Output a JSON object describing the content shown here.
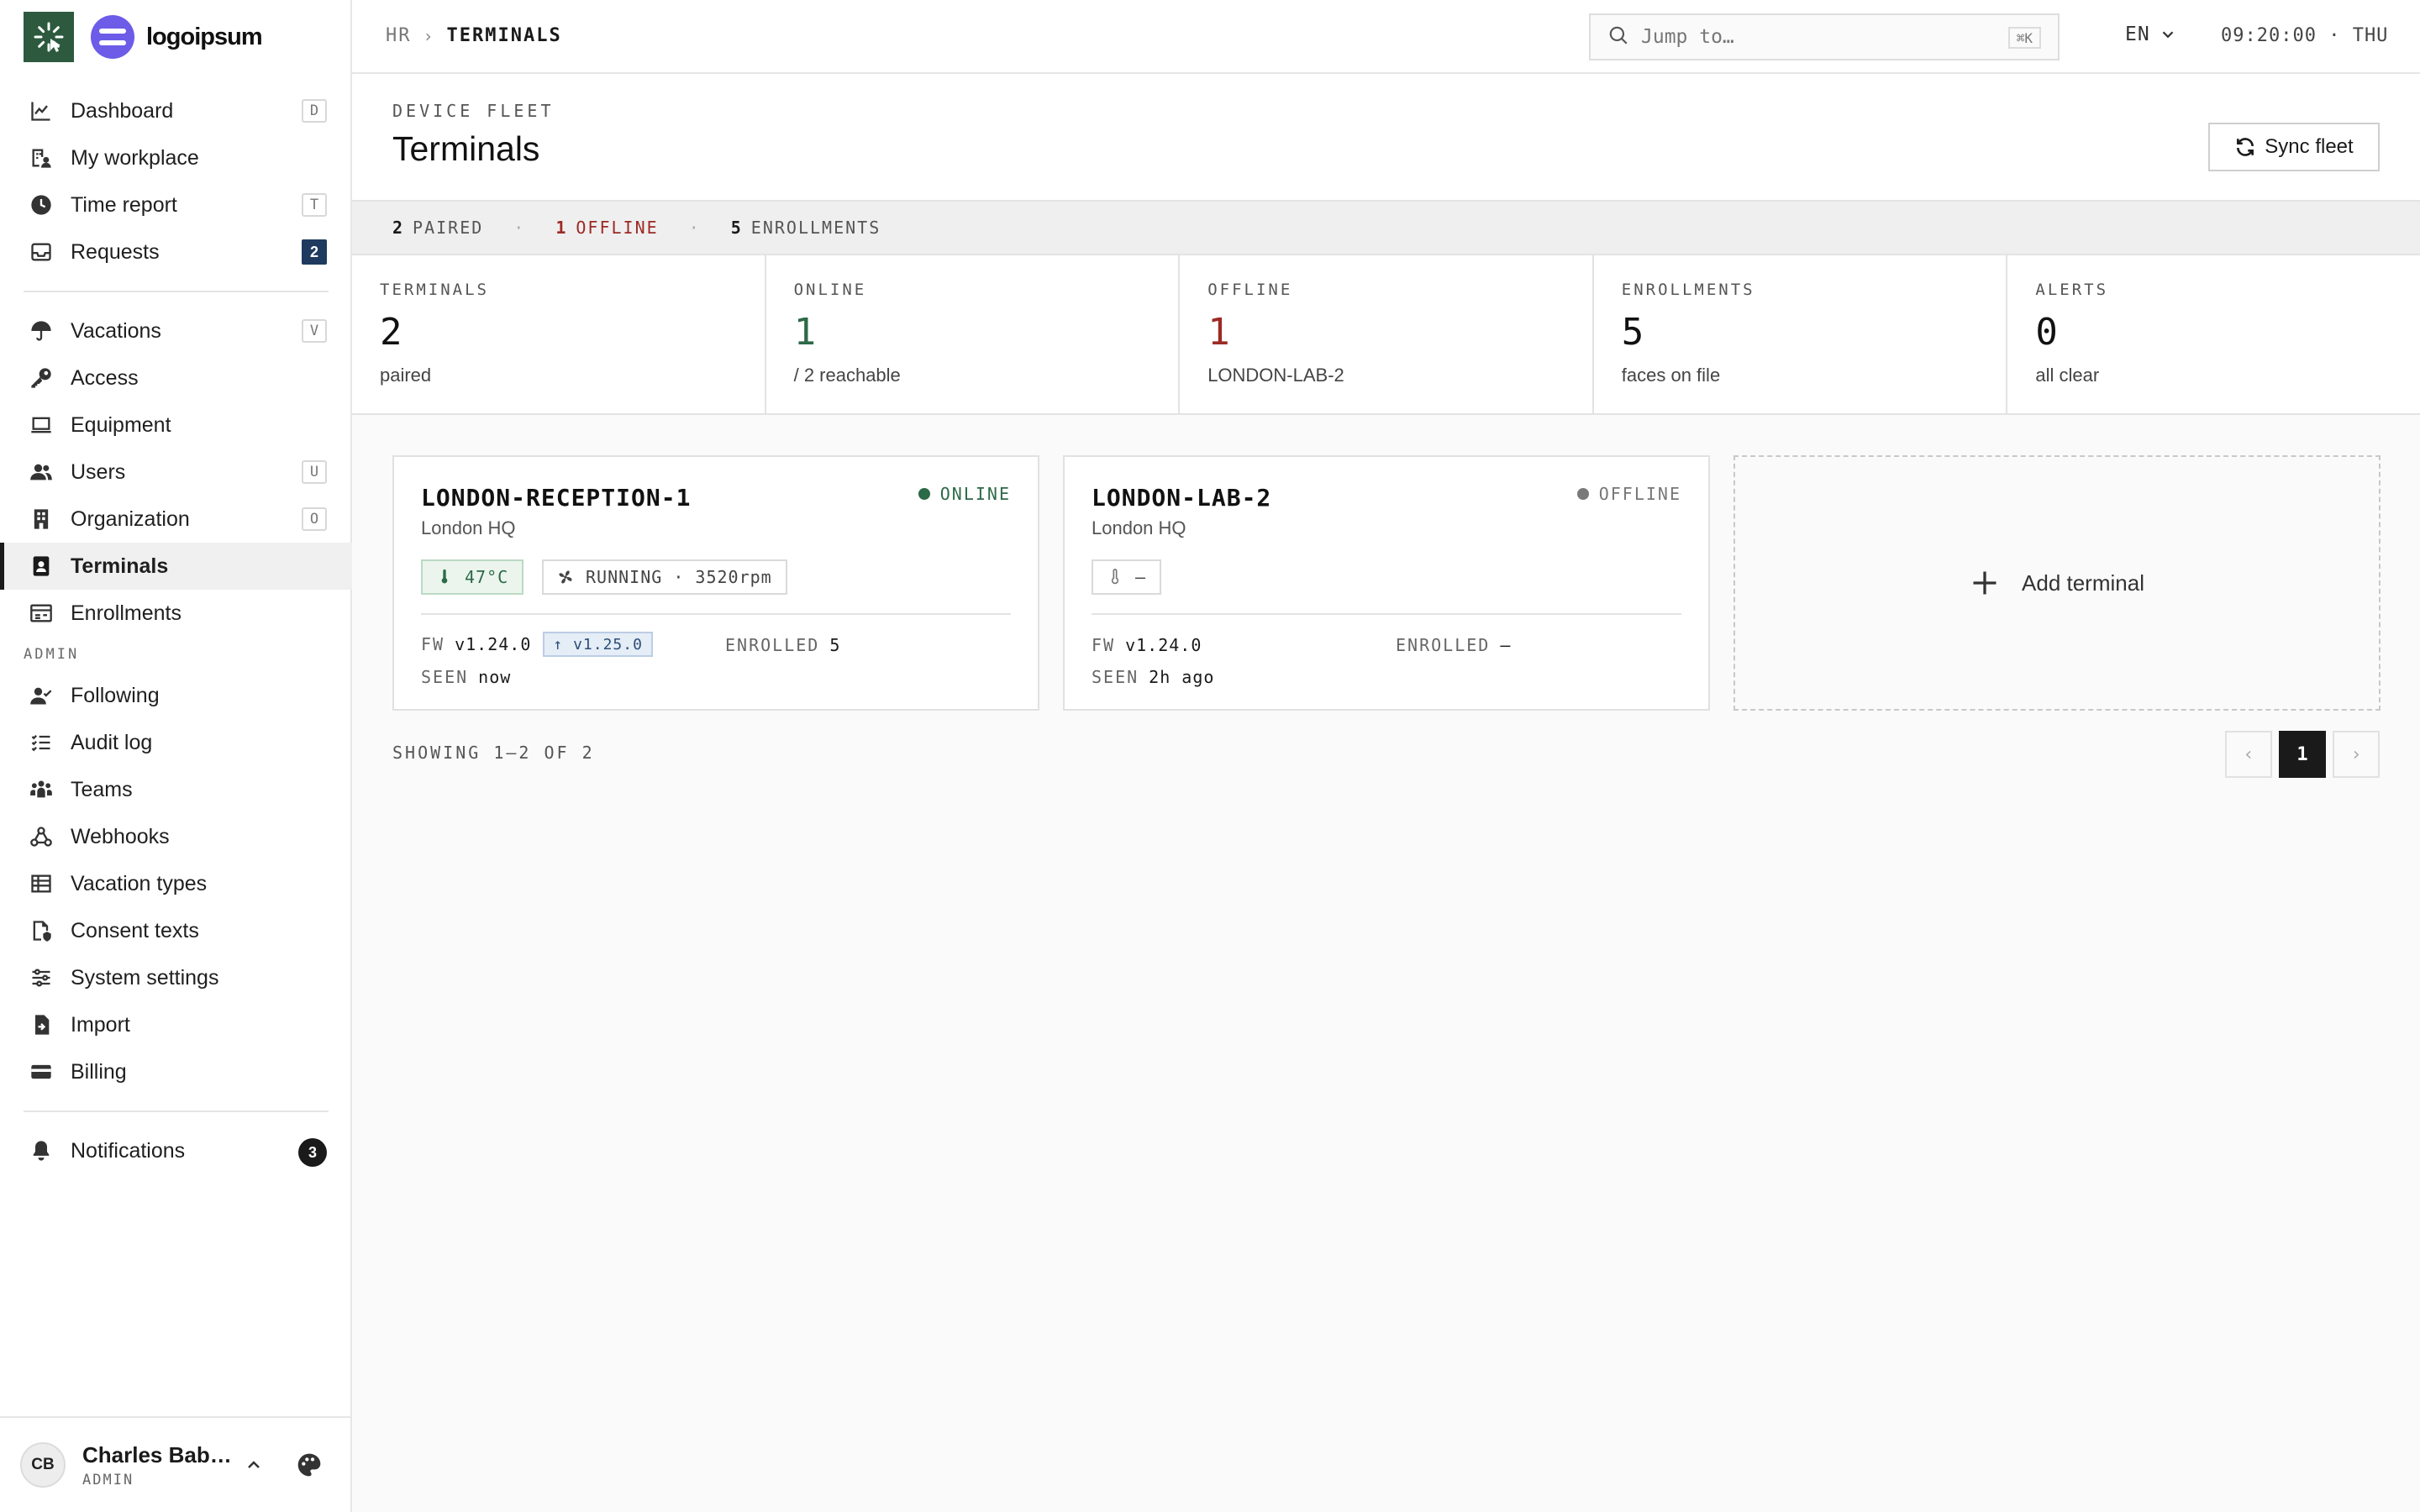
{
  "brand": {
    "name": "logoipsum"
  },
  "sidebar": {
    "items": [
      {
        "label": "Dashboard",
        "icon": "chart-line-icon",
        "kbd": "D"
      },
      {
        "label": "My workplace",
        "icon": "building-person-icon"
      },
      {
        "label": "Time report",
        "icon": "clock-icon",
        "kbd": "T"
      },
      {
        "label": "Requests",
        "icon": "inbox-icon",
        "badge": "2"
      },
      {
        "label": "Vacations",
        "icon": "umbrella-icon",
        "kbd": "V"
      },
      {
        "label": "Access",
        "icon": "key-icon"
      },
      {
        "label": "Equipment",
        "icon": "laptop-icon"
      },
      {
        "label": "Users",
        "icon": "users-icon",
        "kbd": "U"
      },
      {
        "label": "Organization",
        "icon": "building-icon",
        "kbd": "O"
      },
      {
        "label": "Terminals",
        "icon": "badge-id-icon",
        "active": true
      },
      {
        "label": "Enrollments",
        "icon": "id-card-icon"
      }
    ],
    "admin_section_label": "ADMIN",
    "admin_items": [
      {
        "label": "Following",
        "icon": "user-check-icon"
      },
      {
        "label": "Audit log",
        "icon": "list-check-icon"
      },
      {
        "label": "Teams",
        "icon": "team-icon"
      },
      {
        "label": "Webhooks",
        "icon": "webhook-icon"
      },
      {
        "label": "Vacation types",
        "icon": "table-icon"
      },
      {
        "label": "Consent texts",
        "icon": "file-shield-icon"
      },
      {
        "label": "System settings",
        "icon": "sliders-icon"
      },
      {
        "label": "Import",
        "icon": "file-import-icon"
      },
      {
        "label": "Billing",
        "icon": "credit-card-icon"
      }
    ],
    "notifications": {
      "label": "Notifications",
      "icon": "bell-icon",
      "badge": "3"
    },
    "user": {
      "initials": "CB",
      "name": "Charles Bab…",
      "role": "ADMIN"
    }
  },
  "topbar": {
    "breadcrumb": [
      "HR",
      "TERMINALS"
    ],
    "search_placeholder": "Jump to…",
    "search_kbd": "⌘K",
    "language": "EN",
    "clock": "09:20:00 · THU"
  },
  "header": {
    "eyebrow": "DEVICE FLEET",
    "title": "Terminals",
    "sync_label": "Sync fleet"
  },
  "summary": {
    "paired_count": "2",
    "paired_label": "PAIRED",
    "offline_count": "1",
    "offline_label": "OFFLINE",
    "enrollments_count": "5",
    "enrollments_label": "ENROLLMENTS"
  },
  "stats": [
    {
      "label": "TERMINALS",
      "value": "2",
      "sub": "paired",
      "tone": ""
    },
    {
      "label": "ONLINE",
      "value": "1",
      "sub": "/ 2 reachable",
      "tone": "green"
    },
    {
      "label": "OFFLINE",
      "value": "1",
      "sub": "LONDON-LAB-2",
      "tone": "red"
    },
    {
      "label": "ENROLLMENTS",
      "value": "5",
      "sub": "faces on file",
      "tone": ""
    },
    {
      "label": "ALERTS",
      "value": "0",
      "sub": "all clear",
      "tone": ""
    }
  ],
  "terminals": [
    {
      "name": "LONDON-RECEPTION-1",
      "site": "London HQ",
      "status": "ONLINE",
      "status_color": "#2d6a48",
      "temp": "47°C",
      "fan": "RUNNING · 3520rpm",
      "fw_key": "FW",
      "fw": "v1.24.0",
      "fw_update": "↑ v1.25.0",
      "enrolled_key": "ENROLLED",
      "enrolled": "5",
      "seen_key": "SEEN",
      "seen": "now"
    },
    {
      "name": "LONDON-LAB-2",
      "site": "London HQ",
      "status": "OFFLINE",
      "status_color": "#7a7a7a",
      "temp": "—",
      "fw_key": "FW",
      "fw": "v1.24.0",
      "enrolled_key": "ENROLLED",
      "enrolled": "—",
      "seen_key": "SEEN",
      "seen": "2h ago"
    }
  ],
  "add_terminal_label": "Add terminal",
  "pagination": {
    "showing": "SHOWING 1–2 OF 2",
    "prev": "‹",
    "current": "1",
    "next": "›"
  },
  "colors": {
    "brand_green": "#2d5a3f",
    "brand_purple": "#6c5ce7",
    "online": "#2d6a48",
    "offline_red": "#9c2a24",
    "badge_navy": "#1e3a5f"
  }
}
